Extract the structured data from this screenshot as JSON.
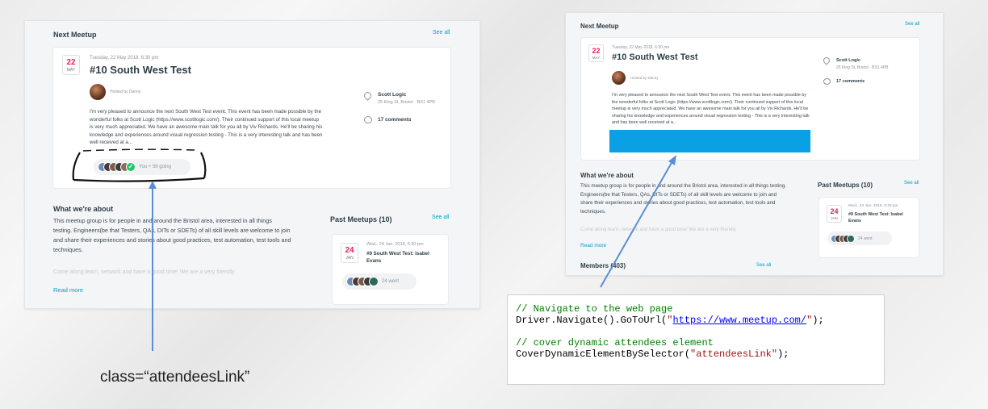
{
  "left_shot": {
    "next_meetup_title": "Next Meetup",
    "see_all": "See all",
    "event": {
      "date_day": "22",
      "date_month": "MAY",
      "datetime": "Tuesday, 22 May 2018, 6:30 pm",
      "title": "#10 South West Test",
      "hosted_by": "Hosted by Danny",
      "description": "I'm very pleased to announce the next South West Test event. This event has been made possible by the wonderful folks at Scott Logic (https://www.scottlogic.com/). Their continued support of this local meetup is very much appreciated. We have an awesome main talk for you all by Viv Richards. He'll be sharing his knowledge and experiences around visual regression testing - This is a very interesting talk and has been well received at a...",
      "venue_name": "Scott Logic",
      "venue_address": "25 King St, Bristol · BS1 4PB",
      "comments": "17 comments",
      "going": "You + 59 going"
    },
    "about_title": "What we're about",
    "about_text": "This meetup group is for people in and around the Bristol area, interested in all things testing. Engineers(be that Testers, QAs, DITs or SDETs) of all skill levels are welcome to join and share their experiences and stories about good practices, test automation, test tools and techniques.",
    "about_faded": "Come along learn, network and have a good time! We are a very friendly",
    "read_more": "Read more",
    "past_title": "Past Meetups (10)",
    "past_see_all": "See all",
    "past_event": {
      "date_day": "24",
      "date_month": "JAN",
      "datetime": "Wed., 24 Jan. 2018, 6:30 pm",
      "title": "#9 South West Test: Isabel Evans",
      "went": "24 went"
    }
  },
  "right_shot": {
    "next_meetup_title": "Next Meetup",
    "see_all": "See all",
    "event": {
      "date_day": "22",
      "date_month": "MAY",
      "datetime": "Tuesday, 22 May 2018, 6:30 pm",
      "title": "#10 South West Test",
      "hosted_by": "Hosted by Danny",
      "description": "I'm very pleased to announce the next South West Test event. This event has been made possible by the wonderful folks at Scott Logic (https://www.scottlogic.com/). Their continued support of this local meetup is very much appreciated. We have an awesome main talk for you all by Viv Richards. He'll be sharing his knowledge and experiences around visual regression testing - This is a very interesting talk and has been well received at a...",
      "venue_name": "Scott Logic",
      "venue_address": "25 King St, Bristol · BS1 4PB",
      "comments": "17 comments"
    },
    "about_title": "What we're about",
    "about_text": "This meetup group is for people in and around the Bristol area, interested in all things testing. Engineers(be that Testers, QAs, DITs or SDETs) of all skill levels are welcome to join and share their experiences and stories about good practices, test automation, test tools and techniques.",
    "about_faded": "Come along learn, network and have a good time! We are a very friendly",
    "read_more": "Read more",
    "members_title": "Members (403)",
    "members_see_all": "See all",
    "past_title": "Past Meetups (10)",
    "past_see_all": "See all",
    "past_event": {
      "date_day": "24",
      "date_month": "JAN",
      "datetime": "Wed., 24 Jan. 2018, 6:30 pm",
      "title": "#9 South West Test: Isabel Evans",
      "went": "24 went"
    }
  },
  "annotation": {
    "class_label": "class=“attendeesLink”"
  },
  "code": {
    "comment1": "// Navigate to the web page",
    "line2_pre": "Driver.Navigate().GoToUrl(",
    "line2_quote_open": "\"",
    "line2_url": "https://www.meetup.com/",
    "line2_quote_close": "\"",
    "line2_post": ");",
    "comment2": "// cover dynamic attendees element",
    "line4_pre": "CoverDynamicElementBySelector(",
    "line4_str": "\"attendeesLink\"",
    "line4_post": ");"
  },
  "colors": {
    "accent": "#00a2c7",
    "date_red": "#e32359",
    "cover_blue": "#0aa0e4",
    "arrow": "#5b8fd4"
  }
}
